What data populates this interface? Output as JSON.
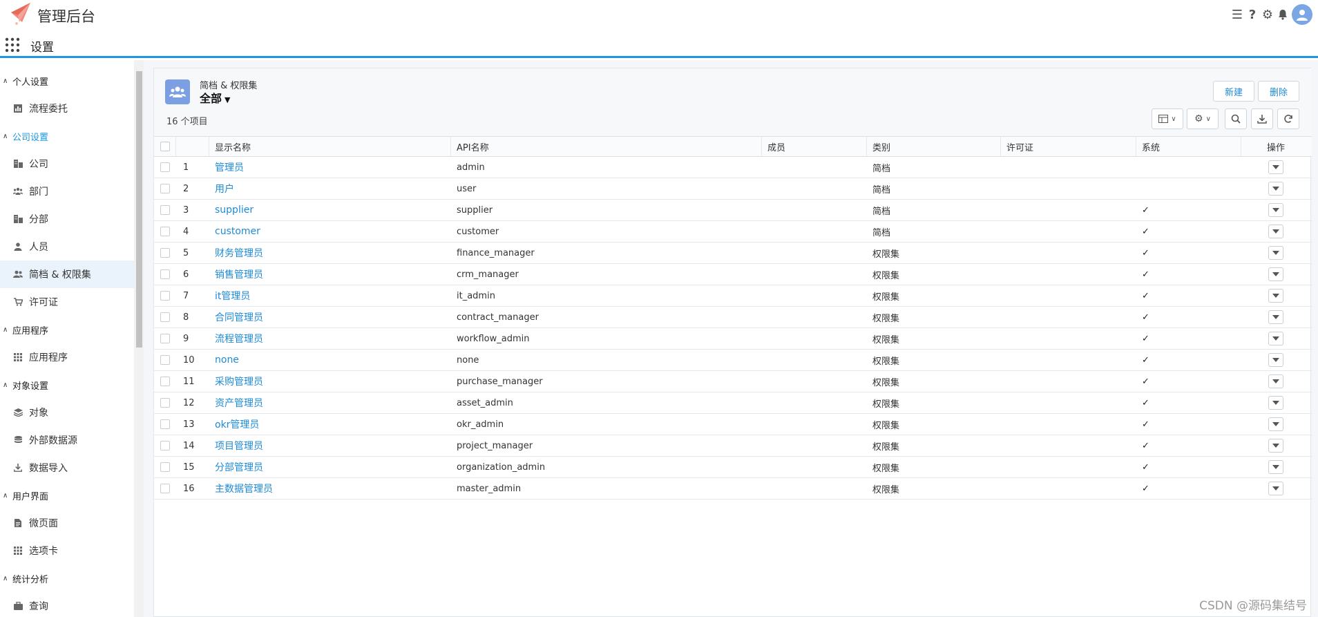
{
  "header": {
    "app_title": "管理后台",
    "sub_title": "设置"
  },
  "sidebar": {
    "items": [
      {
        "type": "group",
        "label": "个人设置",
        "active": false
      },
      {
        "type": "item",
        "label": "流程委托",
        "icon": "bar-chart-icon"
      },
      {
        "type": "group",
        "label": "公司设置",
        "active": true
      },
      {
        "type": "item",
        "label": "公司",
        "icon": "building-icon"
      },
      {
        "type": "item",
        "label": "部门",
        "icon": "users-group-icon"
      },
      {
        "type": "item",
        "label": "分部",
        "icon": "building-icon"
      },
      {
        "type": "item",
        "label": "人员",
        "icon": "user-icon"
      },
      {
        "type": "item",
        "label": "简档 & 权限集",
        "icon": "users-icon",
        "selected": true
      },
      {
        "type": "item",
        "label": "许可证",
        "icon": "cart-icon"
      },
      {
        "type": "group",
        "label": "应用程序",
        "active": false
      },
      {
        "type": "item",
        "label": "应用程序",
        "icon": "apps-grid-icon"
      },
      {
        "type": "group",
        "label": "对象设置",
        "active": false
      },
      {
        "type": "item",
        "label": "对象",
        "icon": "layers-icon"
      },
      {
        "type": "item",
        "label": "外部数据源",
        "icon": "database-icon"
      },
      {
        "type": "item",
        "label": "数据导入",
        "icon": "download-icon"
      },
      {
        "type": "group",
        "label": "用户界面",
        "active": false
      },
      {
        "type": "item",
        "label": "微页面",
        "icon": "file-icon"
      },
      {
        "type": "item",
        "label": "选项卡",
        "icon": "apps-grid-icon"
      },
      {
        "type": "group",
        "label": "统计分析",
        "active": false
      },
      {
        "type": "item",
        "label": "查询",
        "icon": "briefcase-icon"
      }
    ]
  },
  "panel": {
    "subtitle": "简档 & 权限集",
    "title": "全部",
    "count": "16 个项目",
    "new_label": "新建",
    "delete_label": "删除"
  },
  "table": {
    "columns": [
      "显示名称",
      "API名称",
      "成员",
      "类别",
      "许可证",
      "系统",
      "操作"
    ],
    "rows": [
      {
        "num": "1",
        "name": "管理员",
        "api": "admin",
        "cat": "简档",
        "sys": ""
      },
      {
        "num": "2",
        "name": "用户",
        "api": "user",
        "cat": "简档",
        "sys": ""
      },
      {
        "num": "3",
        "name": "supplier",
        "api": "supplier",
        "cat": "简档",
        "sys": "✓"
      },
      {
        "num": "4",
        "name": "customer",
        "api": "customer",
        "cat": "简档",
        "sys": "✓"
      },
      {
        "num": "5",
        "name": "财务管理员",
        "api": "finance_manager",
        "cat": "权限集",
        "sys": "✓"
      },
      {
        "num": "6",
        "name": "销售管理员",
        "api": "crm_manager",
        "cat": "权限集",
        "sys": "✓"
      },
      {
        "num": "7",
        "name": "it管理员",
        "api": "it_admin",
        "cat": "权限集",
        "sys": "✓"
      },
      {
        "num": "8",
        "name": "合同管理员",
        "api": "contract_manager",
        "cat": "权限集",
        "sys": "✓"
      },
      {
        "num": "9",
        "name": "流程管理员",
        "api": "workflow_admin",
        "cat": "权限集",
        "sys": "✓"
      },
      {
        "num": "10",
        "name": "none",
        "api": "none",
        "cat": "权限集",
        "sys": "✓"
      },
      {
        "num": "11",
        "name": "采购管理员",
        "api": "purchase_manager",
        "cat": "权限集",
        "sys": "✓"
      },
      {
        "num": "12",
        "name": "资产管理员",
        "api": "asset_admin",
        "cat": "权限集",
        "sys": "✓"
      },
      {
        "num": "13",
        "name": "okr管理员",
        "api": "okr_admin",
        "cat": "权限集",
        "sys": "✓"
      },
      {
        "num": "14",
        "name": "项目管理员",
        "api": "project_manager",
        "cat": "权限集",
        "sys": "✓"
      },
      {
        "num": "15",
        "name": "分部管理员",
        "api": "organization_admin",
        "cat": "权限集",
        "sys": "✓"
      },
      {
        "num": "16",
        "name": "主数据管理员",
        "api": "master_admin",
        "cat": "权限集",
        "sys": "✓"
      }
    ]
  },
  "watermark": "CSDN @源码集结号",
  "colors": {
    "accent": "#1d97e0",
    "link": "#1d8ad6",
    "object_icon": "#7c9fe3"
  }
}
